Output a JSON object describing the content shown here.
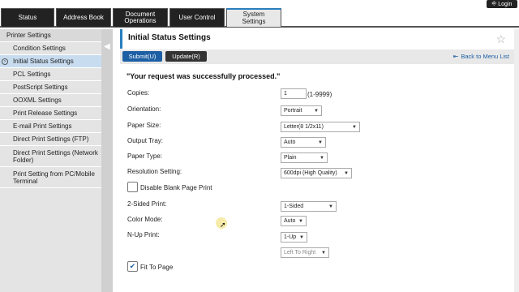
{
  "tabs": [
    {
      "label": "Status"
    },
    {
      "label": "Address Book"
    },
    {
      "label": "Document Operations"
    },
    {
      "label": "User Control"
    },
    {
      "label": "System Settings"
    }
  ],
  "login_label": "Login",
  "sidebar": {
    "items": [
      {
        "label": "Printer Settings"
      },
      {
        "label": "Condition Settings"
      },
      {
        "label": "Initial Status Settings"
      },
      {
        "label": "PCL Settings"
      },
      {
        "label": "PostScript Settings"
      },
      {
        "label": "OOXML Settings"
      },
      {
        "label": "Print Release Settings"
      },
      {
        "label": "E-mail Print Settings"
      },
      {
        "label": "Direct Print Settings (FTP)"
      },
      {
        "label": "Direct Print Settings (Network Folder)"
      },
      {
        "label": "Print Setting from PC/Mobile Terminal"
      }
    ]
  },
  "page": {
    "title": "Initial Status Settings",
    "submit_label": "Submit(U)",
    "update_label": "Update(R)",
    "back_label": "Back to Menu List",
    "message": "\"Your request was successfully processed.\""
  },
  "form": {
    "copies": {
      "label": "Copies:",
      "value": "1",
      "range": "(1-9999)"
    },
    "orientation": {
      "label": "Orientation:",
      "value": "Portrait"
    },
    "paper_size": {
      "label": "Paper Size:",
      "value": "Letter(8 1/2x11)"
    },
    "output_tray": {
      "label": "Output Tray:",
      "value": "Auto"
    },
    "paper_type": {
      "label": "Paper Type:",
      "value": "Plain"
    },
    "resolution": {
      "label": "Resolution Setting:",
      "value": "600dpi (High Quality)"
    },
    "disable_blank": {
      "label": "Disable Blank Page Print",
      "checked": false
    },
    "two_sided": {
      "label": "2-Sided Print:",
      "value": "1-Sided"
    },
    "color_mode": {
      "label": "Color Mode:",
      "value": "Auto"
    },
    "nup": {
      "label": "N-Up Print:",
      "value": "1-Up",
      "order": "Left To Right"
    },
    "fit_to_page": {
      "label": "Fit To Page",
      "checked": true
    }
  },
  "colors": {
    "accent": "#1d5fa4",
    "active_item": "#c8dcf0"
  }
}
